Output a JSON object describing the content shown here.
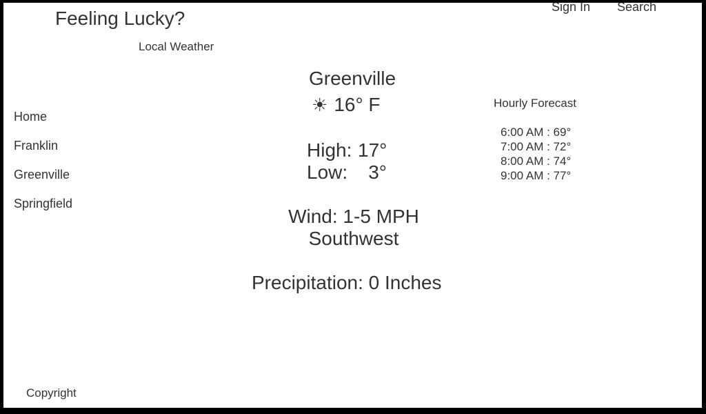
{
  "header": {
    "title": "Feeling Lucky?",
    "subtitle": "Local Weather",
    "sign_in": "Sign In",
    "search": "Search"
  },
  "nav": {
    "items": [
      "Home",
      "Franklin",
      "Greenville",
      "Springfield"
    ]
  },
  "weather": {
    "city": "Greenville",
    "condition_icon": "sun-icon",
    "condition_glyph": "☀",
    "current_temp": "16° F",
    "high_label": "High:",
    "high_value": "17°",
    "low_label": "Low:",
    "low_value": "3°",
    "wind_line1": "Wind: 1-5 MPH",
    "wind_line2": "Southwest",
    "precipitation": "Precipitation: 0 Inches"
  },
  "hourly": {
    "title": "Hourly Forecast",
    "items": [
      "6:00 AM : 69°",
      "7:00 AM : 72°",
      "8:00 AM : 74°",
      "9:00 AM : 77°"
    ]
  },
  "footer": {
    "copyright": "Copyright"
  }
}
